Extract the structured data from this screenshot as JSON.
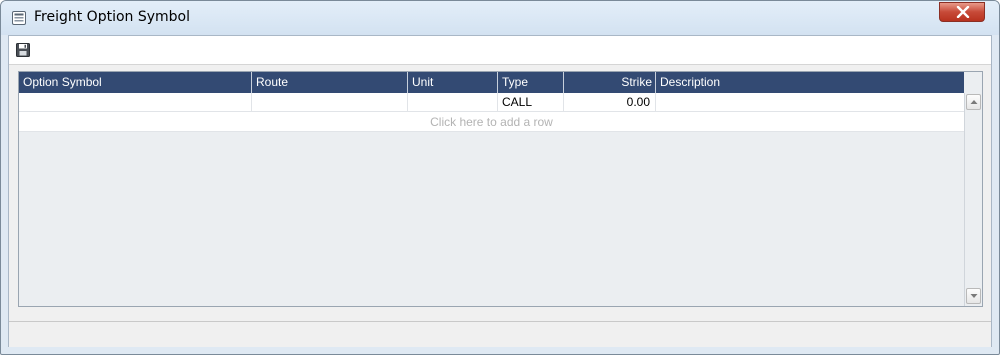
{
  "window": {
    "title": "Freight Option Symbol"
  },
  "toolbar": {
    "save_icon": "save-icon"
  },
  "grid": {
    "columns": [
      "Option Symbol",
      "Route",
      "Unit",
      "Type",
      "Strike",
      "Description"
    ],
    "rows": [
      {
        "option_symbol": "",
        "route": "",
        "unit": "",
        "type": "CALL",
        "strike": "0.00",
        "description": ""
      }
    ],
    "add_row_text": "Click here to add a row"
  },
  "colors": {
    "header_bg": "#334a73",
    "header_text": "#ffffff",
    "close_button": "#c74a38",
    "placeholder_text": "#b3b3b3"
  }
}
